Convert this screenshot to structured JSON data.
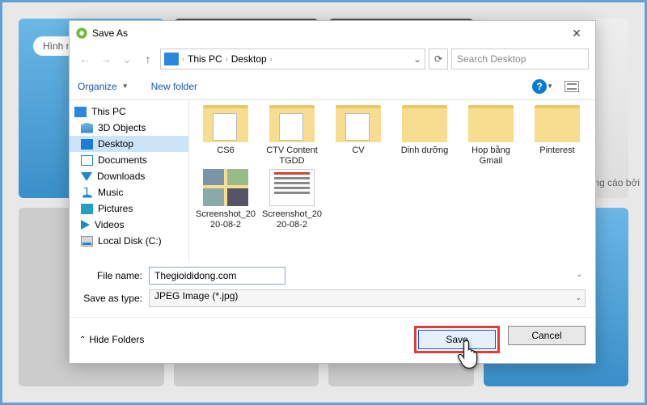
{
  "bg": {
    "topleft_label": "Hình nền",
    "ad_text": "ảng cáo bởi"
  },
  "dialog": {
    "title": "Save As",
    "nav": {
      "breadcrumbs": [
        "This PC",
        "Desktop"
      ],
      "search_placeholder": "Search Desktop"
    },
    "toolbar": {
      "organize": "Organize",
      "new_folder": "New folder"
    },
    "tree": {
      "root": "This PC",
      "items": [
        {
          "label": "3D Objects",
          "icon": "f3d"
        },
        {
          "label": "Desktop",
          "icon": "desktop",
          "selected": true
        },
        {
          "label": "Documents",
          "icon": "docs"
        },
        {
          "label": "Downloads",
          "icon": "down"
        },
        {
          "label": "Music",
          "icon": "music"
        },
        {
          "label": "Pictures",
          "icon": "pics"
        },
        {
          "label": "Videos",
          "icon": "vids"
        },
        {
          "label": "Local Disk (C:)",
          "icon": "disk"
        }
      ]
    },
    "files": [
      {
        "label": "CS6",
        "kind": "folder"
      },
      {
        "label": "CTV Content TGDD",
        "kind": "folder"
      },
      {
        "label": "CV",
        "kind": "folder"
      },
      {
        "label": "Dinh dưỡng",
        "kind": "folder"
      },
      {
        "label": "Hop bằng Gmail",
        "kind": "folder"
      },
      {
        "label": "Pinterest",
        "kind": "folder"
      },
      {
        "label": "Screenshot_2020-08-2",
        "kind": "pic"
      },
      {
        "label": "Screenshot_2020-08-2",
        "kind": "pic"
      }
    ],
    "fields": {
      "filename_label": "File name:",
      "filename_value": "Thegioididong.com",
      "type_label": "Save as type:",
      "type_value": "JPEG Image (*.jpg)"
    },
    "footer": {
      "hide_folders": "Hide Folders",
      "save": "Save",
      "cancel": "Cancel"
    }
  }
}
